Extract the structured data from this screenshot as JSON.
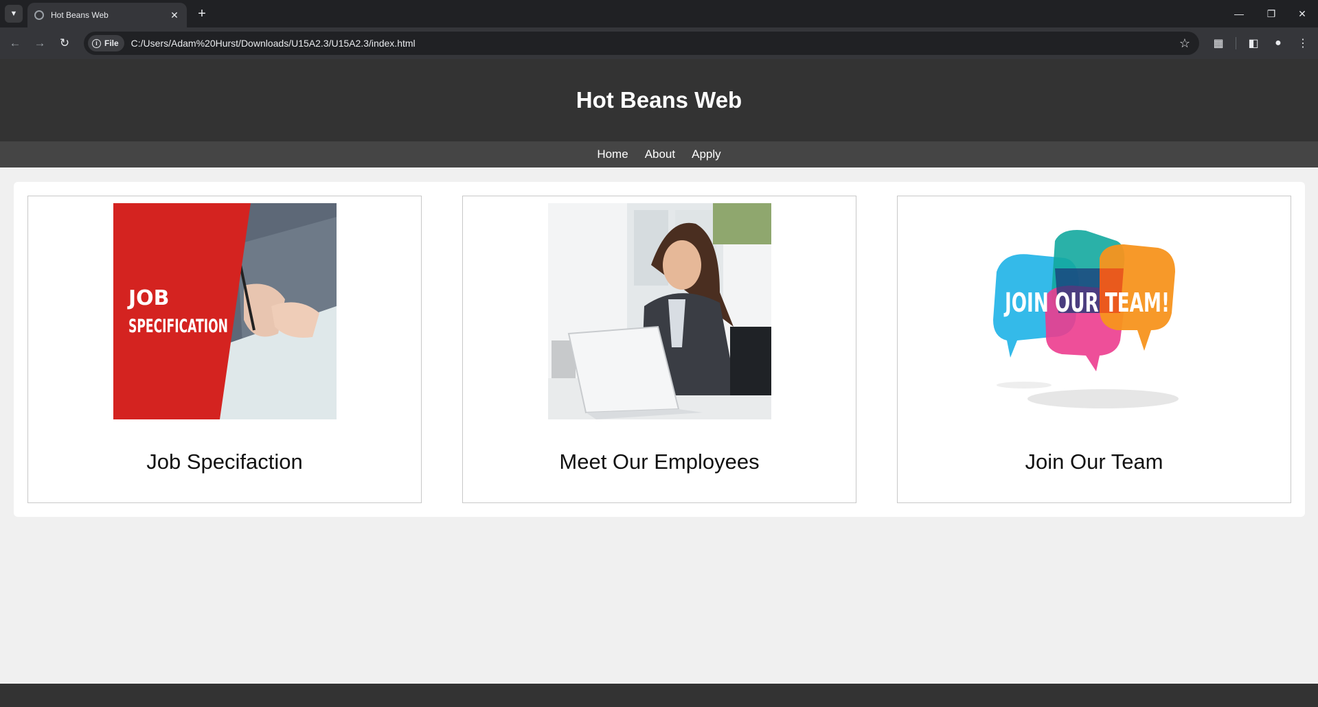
{
  "browser": {
    "tab_title": "Hot Beans Web",
    "chip_label": "File",
    "url": "C:/Users/Adam%20Hurst/Downloads/U15A2.3/U15A2.3/index.html"
  },
  "site": {
    "title": "Hot Beans Web",
    "nav": [
      "Home",
      "About",
      "Apply"
    ]
  },
  "cards": [
    {
      "caption": "Job Specifaction",
      "image_text": [
        "JOB",
        "SPECIFICATION"
      ]
    },
    {
      "caption": "Meet Our Employees"
    },
    {
      "caption": "Join Our Team",
      "image_text": "JOIN OUR TEAM!"
    }
  ],
  "colors": {
    "header_bg": "#333333",
    "nav_bg": "#454545",
    "page_bg": "#f0f0f0",
    "job_red": "#d42320"
  }
}
